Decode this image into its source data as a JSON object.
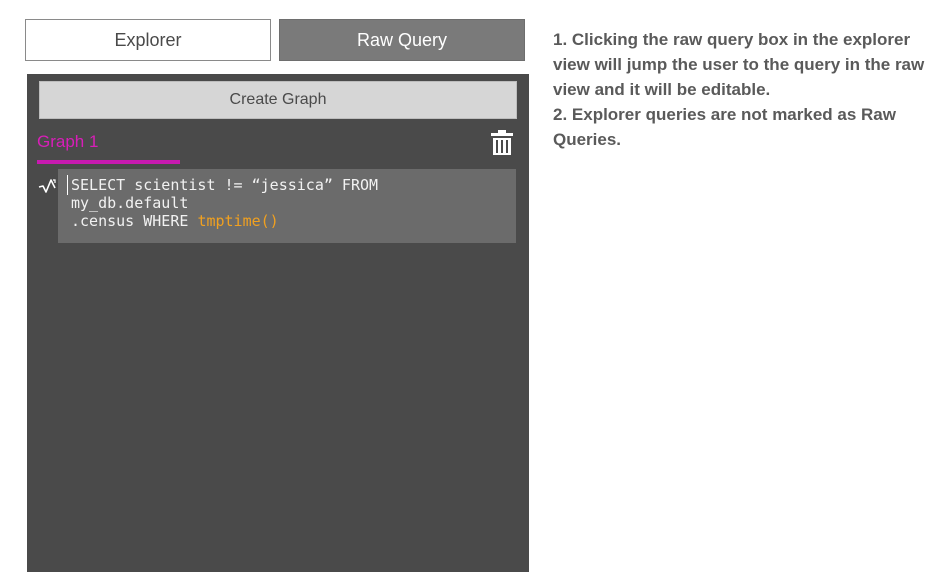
{
  "tabs": {
    "explorer_label": "Explorer",
    "raw_query_label": "Raw Query"
  },
  "panel": {
    "create_graph_label": "Create Graph",
    "graph_tab_label": "Graph 1",
    "query": {
      "line1": "SELECT scientist != “jessica” FROM",
      "line2": "my_db.default",
      "line3_prefix": ".census WHERE ",
      "line3_func": "tmptime()"
    }
  },
  "notes": [
    "1. Clicking the raw query box in the explorer view will jump the user to the query in the raw view and it will be editable.",
    "2. Explorer queries are not marked as Raw Queries."
  ],
  "colors": {
    "accent": "#c81ab0",
    "panel_bg": "#4a4a4a",
    "query_bg": "#6b6b6b",
    "function_highlight": "#f0a020"
  },
  "icons": {
    "delete": "trash-icon",
    "query_type": "query-graph-icon"
  }
}
